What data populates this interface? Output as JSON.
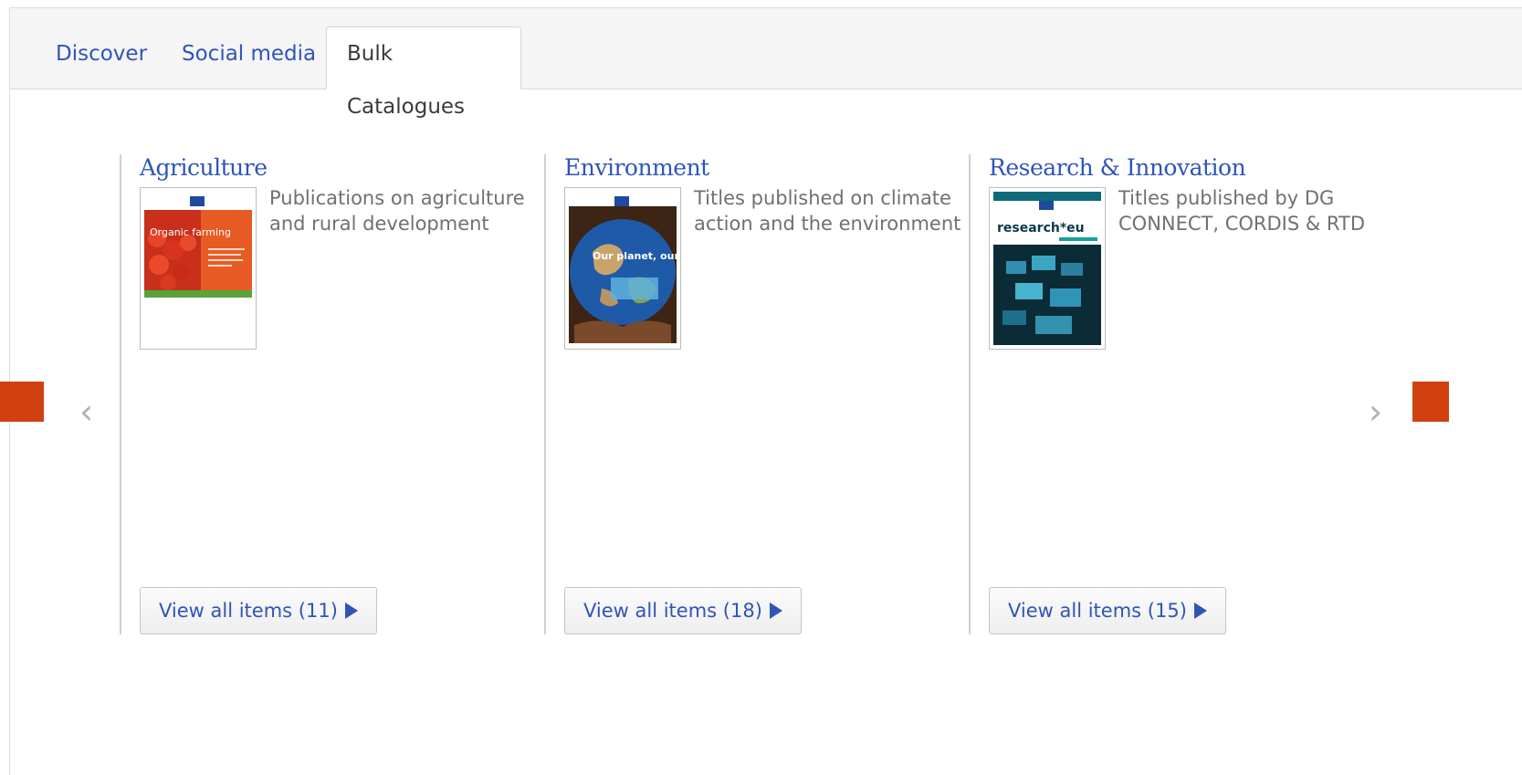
{
  "tabs": [
    {
      "label": "Discover"
    },
    {
      "label": "Social media"
    },
    {
      "label": "Bulk Catalogues"
    }
  ],
  "active_tab": "Bulk Catalogues",
  "carousel": {
    "prev_icon": "chevron-left-icon",
    "next_icon": "chevron-right-icon",
    "items": [
      {
        "title": "Agriculture",
        "description": "Publications on agriculture and rural development",
        "button_label": "View all items (11)",
        "cover_text": "Organic farming"
      },
      {
        "title": "Environment",
        "description": "Titles published on climate action and the environment",
        "button_label": "View all items (18)",
        "cover_text": "Our planet, our future"
      },
      {
        "title": "Research & Innovation",
        "description": "Titles published by DG CONNECT, CORDIS & RTD",
        "button_label": "View all items (15)",
        "cover_text": "research*eu"
      }
    ]
  },
  "colors": {
    "link": "#2f55b8",
    "accent": "#d0410f"
  }
}
